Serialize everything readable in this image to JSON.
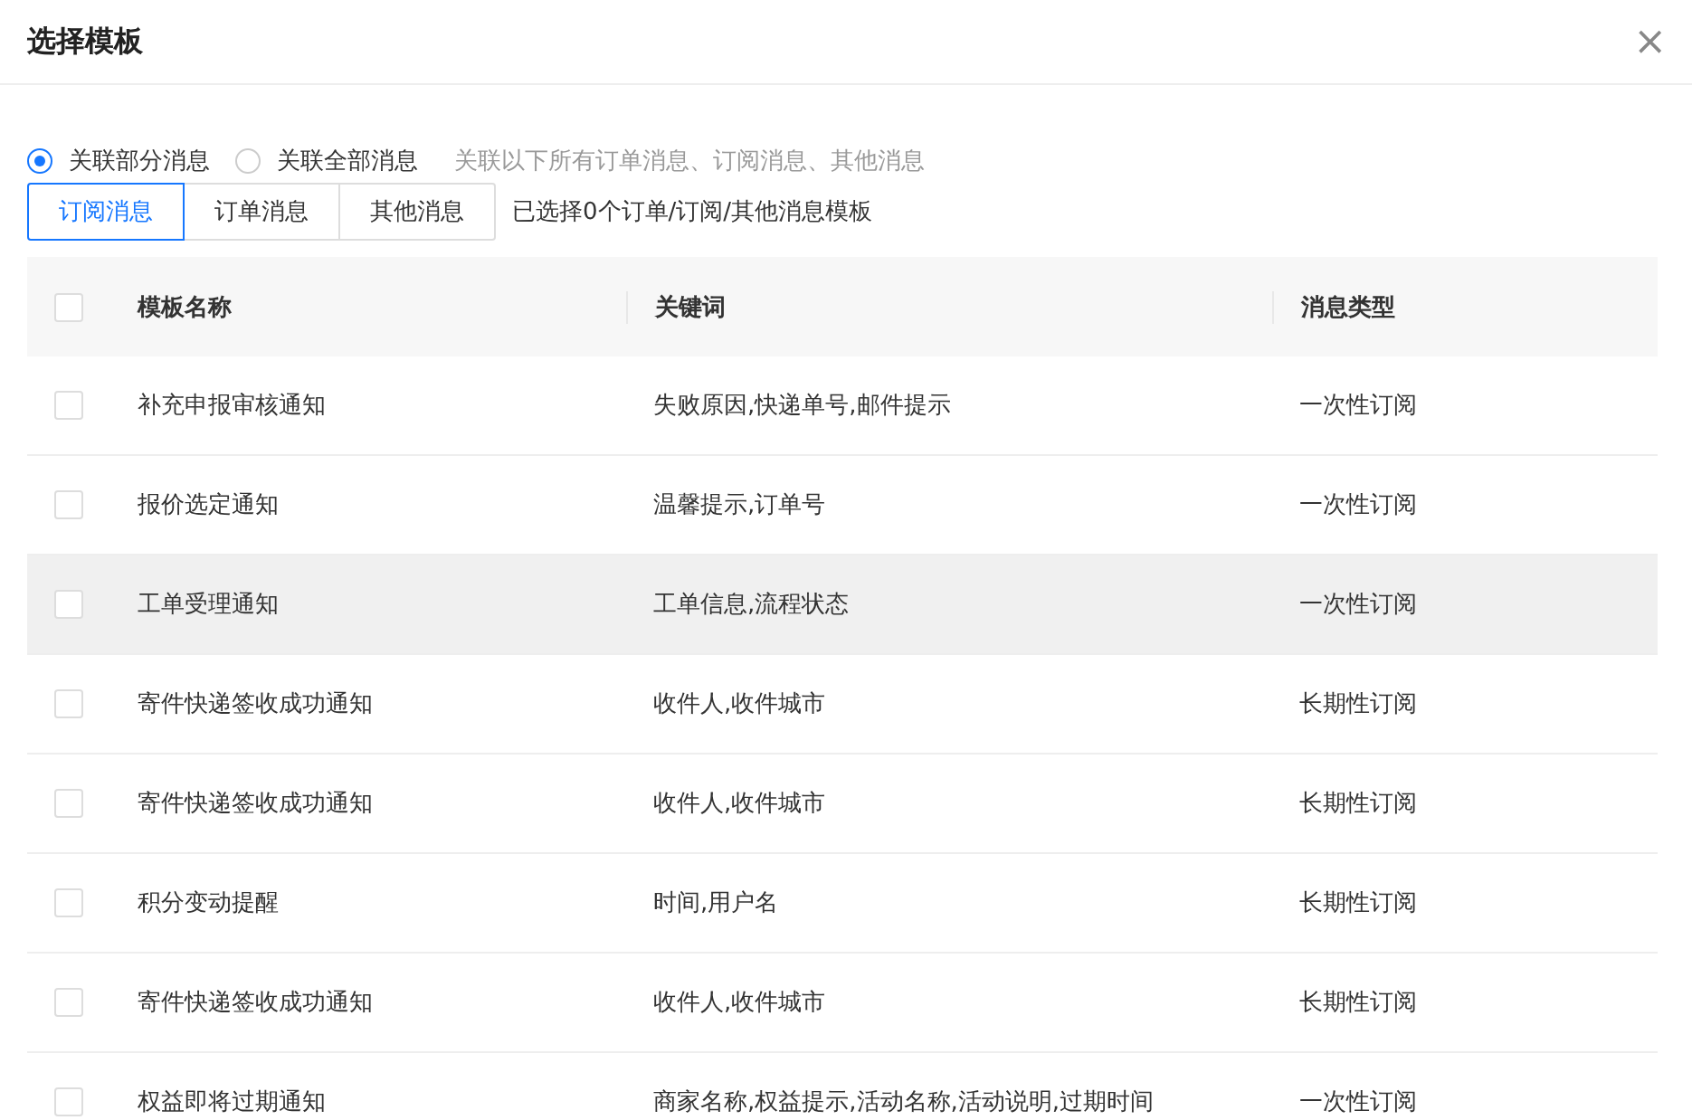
{
  "dialog": {
    "title": "选择模板",
    "close": "×"
  },
  "scope": [
    {
      "label": "关联部分消息",
      "selected": true
    },
    {
      "label": "关联全部消息",
      "selected": false
    }
  ],
  "scope_hint": "关联以下所有订单消息、订阅消息、其他消息",
  "tabs": [
    {
      "label": "订阅消息",
      "selected": true
    },
    {
      "label": "订单消息",
      "selected": false
    },
    {
      "label": "其他消息",
      "selected": false
    }
  ],
  "selection_summary": "已选择0个订单/订阅/其他消息模板",
  "table": {
    "all_checked": false,
    "columns": [
      "模板名称",
      "关键词",
      "消息类型"
    ],
    "rows": [
      {
        "checked": false,
        "highlighted": false,
        "cells": [
          "补充申报审核通知",
          "失败原因,快递单号,邮件提示",
          "一次性订阅"
        ]
      },
      {
        "checked": false,
        "highlighted": false,
        "cells": [
          "报价选定通知",
          "温馨提示,订单号",
          "一次性订阅"
        ]
      },
      {
        "checked": false,
        "highlighted": true,
        "cells": [
          "工单受理通知",
          "工单信息,流程状态",
          "一次性订阅"
        ]
      },
      {
        "checked": false,
        "highlighted": false,
        "cells": [
          "寄件快递签收成功通知",
          "收件人,收件城市",
          "长期性订阅"
        ]
      },
      {
        "checked": false,
        "highlighted": false,
        "cells": [
          "寄件快递签收成功通知",
          "收件人,收件城市",
          "长期性订阅"
        ]
      },
      {
        "checked": false,
        "highlighted": false,
        "cells": [
          "积分变动提醒",
          "时间,用户名",
          "长期性订阅"
        ]
      },
      {
        "checked": false,
        "highlighted": false,
        "cells": [
          "寄件快递签收成功通知",
          "收件人,收件城市",
          "长期性订阅"
        ]
      },
      {
        "checked": false,
        "highlighted": false,
        "cells": [
          "权益即将过期通知",
          "商家名称,权益提示,活动名称,活动说明,过期时间",
          "一次性订阅"
        ]
      }
    ]
  }
}
